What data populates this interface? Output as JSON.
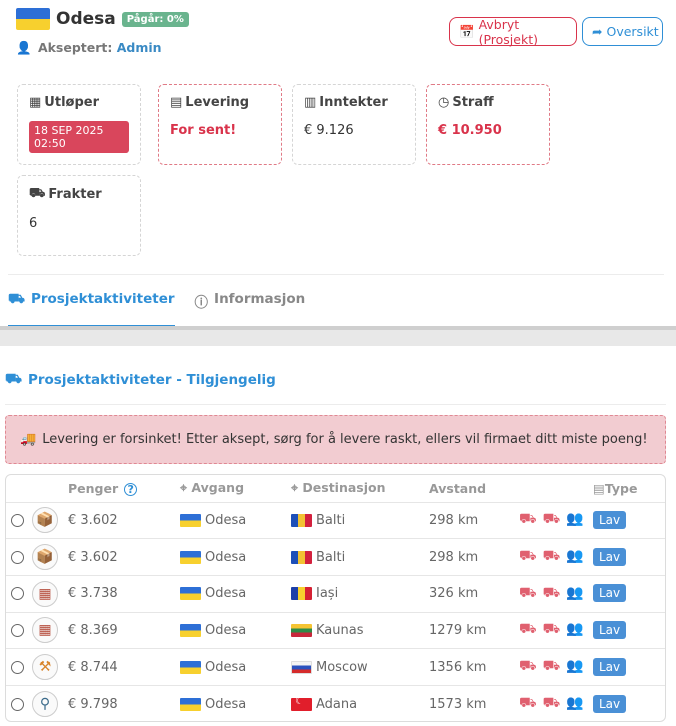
{
  "header": {
    "title": "Odesa",
    "status_badge": "Pågår: 0%",
    "accepted_label": "Akseptert:",
    "accepted_by": "Admin",
    "cancel_button": "Avbryt (Prosjekt)",
    "overview_button": "Oversikt"
  },
  "cards": {
    "expires": {
      "label": "Utløper",
      "value": "18 SEP 2025 02:50"
    },
    "delivery": {
      "label": "Levering",
      "value": "For sent!"
    },
    "income": {
      "label": "Inntekter",
      "value": "€ 9.126"
    },
    "penalty": {
      "label": "Straff",
      "value": "€ 10.950"
    },
    "freight": {
      "label": "Frakter",
      "value": "6"
    }
  },
  "tabs": [
    {
      "label": "Prosjektaktiviteter",
      "active": true
    },
    {
      "label": "Informasjon",
      "active": false
    }
  ],
  "section_title": "Prosjektaktiviteter - Tilgjengelig",
  "alert_text": "Levering er forsinket! Etter aksept, sørg for å levere raskt, ellers vil firmaet ditt miste poeng!",
  "table": {
    "headers": {
      "money": "Penger",
      "departure": "Avgang",
      "destination": "Destinasjon",
      "distance": "Avstand",
      "type": "Type"
    },
    "rows": [
      {
        "cargo_icon": "box-icon",
        "money": "€ 3.602",
        "departure": "Odesa",
        "destination": "Balti",
        "dest_flag": "md",
        "distance": "298 km",
        "type": "Lav"
      },
      {
        "cargo_icon": "grey-box-icon",
        "money": "€ 3.602",
        "departure": "Odesa",
        "destination": "Balti",
        "dest_flag": "md",
        "distance": "298 km",
        "type": "Lav"
      },
      {
        "cargo_icon": "bricks-icon",
        "money": "€ 3.738",
        "departure": "Odesa",
        "destination": "Iași",
        "dest_flag": "ro",
        "distance": "326 km",
        "type": "Lav"
      },
      {
        "cargo_icon": "bricks-icon",
        "money": "€ 8.369",
        "departure": "Odesa",
        "destination": "Kaunas",
        "dest_flag": "lt",
        "distance": "1279 km",
        "type": "Lav"
      },
      {
        "cargo_icon": "tool-icon",
        "money": "€ 8.744",
        "departure": "Odesa",
        "destination": "Moscow",
        "dest_flag": "ru",
        "distance": "1356 km",
        "type": "Lav"
      },
      {
        "cargo_icon": "person-icon",
        "money": "€ 9.798",
        "departure": "Odesa",
        "destination": "Adana",
        "dest_flag": "tr",
        "distance": "1573 km",
        "type": "Lav"
      }
    ]
  },
  "colors": {
    "accent": "#2f8fd6",
    "danger": "#d9334b",
    "success": "#6ab48e"
  }
}
